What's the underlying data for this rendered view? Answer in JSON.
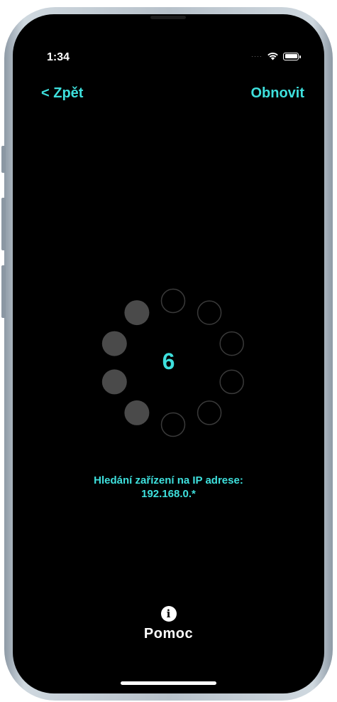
{
  "status_bar": {
    "time": "1:34",
    "cellular": "····",
    "wifi_icon": "wifi-icon",
    "battery_icon": "battery-icon"
  },
  "nav": {
    "back_label": "< Zpět",
    "refresh_label": "Obnovit"
  },
  "scanner": {
    "countdown": "6",
    "active_dots": 4,
    "total_dots": 10,
    "search_label": "Hledání zařízení na IP adrese:",
    "ip_range": "192.168.0.*"
  },
  "help": {
    "icon": "info-icon",
    "label": "Pomoc"
  },
  "colors": {
    "accent": "#3ee0dd",
    "background": "#000000",
    "dot_active": "#4a4a4a",
    "dot_outline": "#3a3a3a"
  }
}
